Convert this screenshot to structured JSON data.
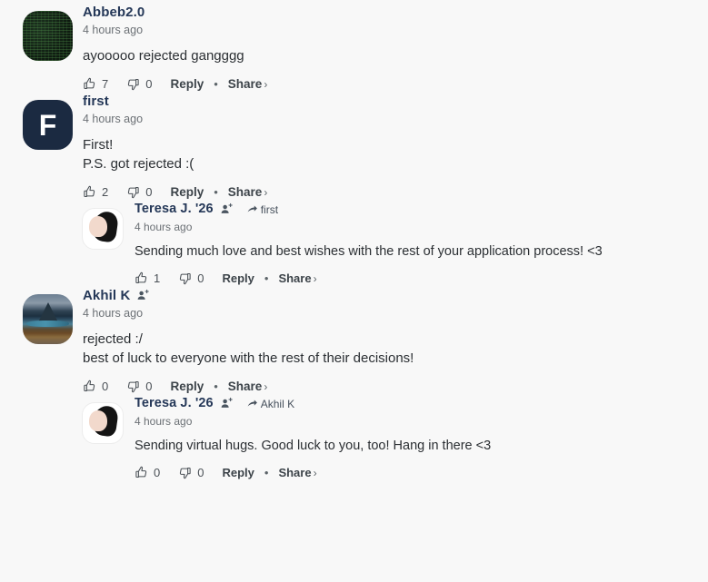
{
  "theme": {
    "background": "#f8f8f8",
    "username_color": "#253858",
    "body_text_color": "#2b2f33",
    "muted_color": "#6b7075",
    "action_color": "#3c4349"
  },
  "labels": {
    "reply": "Reply",
    "share": "Share",
    "share_chevron": "›",
    "separator_dot": "•"
  },
  "icons": {
    "thumbs_up": "thumbs-up-icon",
    "thumbs_down": "thumbs-down-icon",
    "person_add": "person-add-icon",
    "reply_arrow": "reply-arrow-icon"
  },
  "comments": [
    {
      "id": "c1",
      "username": "Abbeb2.0",
      "timestamp": "4 hours ago",
      "avatar_kind": "matrix",
      "avatar_letter": "",
      "has_person_add": false,
      "reply_to": null,
      "lines": [
        "ayooooo rejected gangggg"
      ],
      "upvotes": "7",
      "downvotes": "0",
      "replies": []
    },
    {
      "id": "c2",
      "username": "first",
      "timestamp": "4 hours ago",
      "avatar_kind": "navy-letter",
      "avatar_letter": "F",
      "has_person_add": false,
      "reply_to": null,
      "lines": [
        "First!",
        "P.S. got rejected :("
      ],
      "upvotes": "2",
      "downvotes": "0",
      "replies": [
        {
          "id": "c2r1",
          "username": "Teresa J. '26",
          "timestamp": "4 hours ago",
          "avatar_kind": "portrait",
          "avatar_letter": "",
          "has_person_add": true,
          "reply_to": "first",
          "lines": [
            "Sending much love and best wishes with the rest of your application process! <3"
          ],
          "upvotes": "1",
          "downvotes": "0"
        }
      ]
    },
    {
      "id": "c3",
      "username": "Akhil K",
      "timestamp": "4 hours ago",
      "avatar_kind": "mountain",
      "avatar_letter": "",
      "has_person_add": true,
      "reply_to": null,
      "lines": [
        "rejected :/",
        "best of luck to everyone with the rest of their decisions!"
      ],
      "upvotes": "0",
      "downvotes": "0",
      "replies": [
        {
          "id": "c3r1",
          "username": "Teresa J. '26",
          "timestamp": "4 hours ago",
          "avatar_kind": "portrait",
          "avatar_letter": "",
          "has_person_add": true,
          "reply_to": "Akhil K",
          "lines": [
            "Sending virtual hugs. Good luck to you, too! Hang in there <3"
          ],
          "upvotes": "0",
          "downvotes": "0"
        }
      ]
    }
  ]
}
